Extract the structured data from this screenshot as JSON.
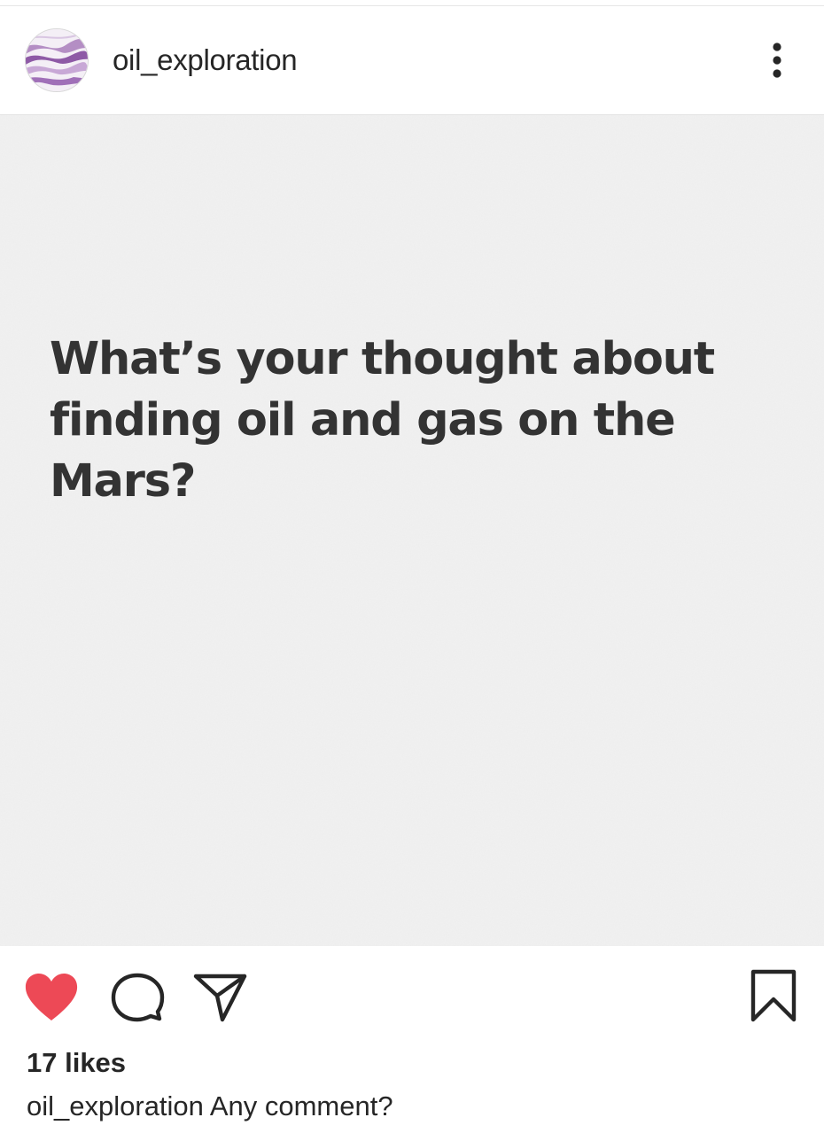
{
  "post": {
    "username": "oil_exploration",
    "image_text": "What’s your thought about finding oil and gas on the Mars?",
    "likes_label": "17 likes",
    "caption_username": "oil_exploration",
    "caption_text": "Any comment?"
  },
  "icons": {
    "avatar": "avatar",
    "more": "more-options-icon",
    "like": "heart-icon",
    "comment": "comment-icon",
    "share": "share-icon",
    "save": "bookmark-icon"
  },
  "colors": {
    "like_active": "#ed4956",
    "text": "#262626",
    "image_bg": "#f1f1f1",
    "image_text": "#333333"
  },
  "state": {
    "liked": true
  }
}
